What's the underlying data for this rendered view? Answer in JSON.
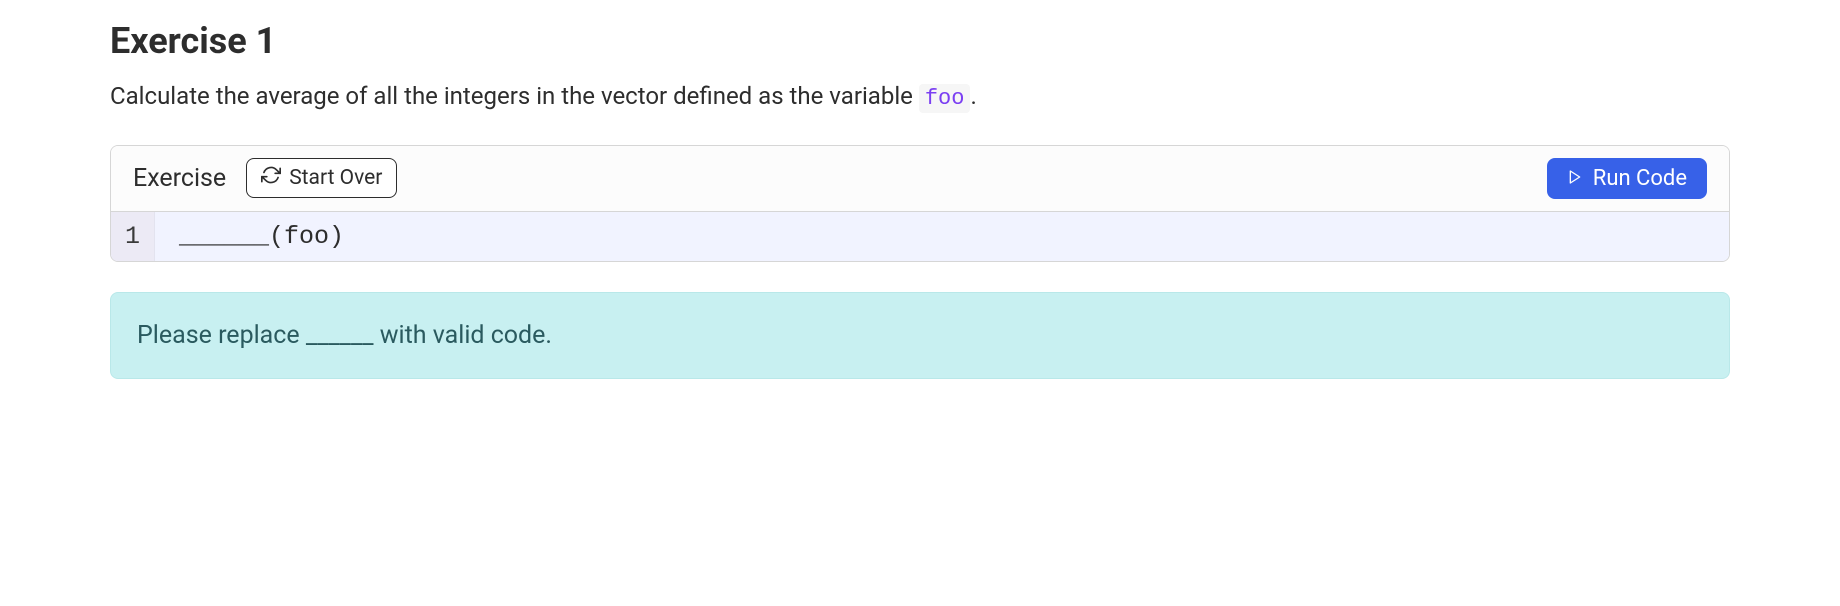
{
  "title": "Exercise 1",
  "description": {
    "prefix": "Calculate the average of all the integers in the vector defined as the variable ",
    "code_token": "foo",
    "suffix": "."
  },
  "toolbar": {
    "label": "Exercise",
    "start_over_label": "Start Over",
    "run_code_label": "Run Code"
  },
  "editor": {
    "line_number": "1",
    "code": "______(foo)"
  },
  "message": "Please replace ______ with valid code."
}
